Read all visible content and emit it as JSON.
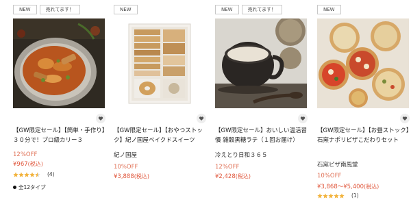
{
  "products": [
    {
      "badges": [
        "NEW",
        "売れてます！"
      ],
      "title": "【GW限定セール】【簡単・手作り】３０分で！プロ級カリー３",
      "shop": "",
      "discount": "12%OFF",
      "price": "¥967",
      "tax": "(税込)",
      "rating": 4.5,
      "review_count": "(4)",
      "types": "全12タイプ"
    },
    {
      "badges": [
        "NEW"
      ],
      "title": "【GW限定セール】【おやつストック】紀ノ国屋ベイクドスイーツ",
      "shop": "紀ノ国屋",
      "discount": "10%OFF",
      "price": "¥3,888",
      "tax": "(税込)"
    },
    {
      "badges": [
        "NEW",
        "売れてます！"
      ],
      "title": "【GW限定セール】おいしい温活習慣 雑穀黒糖ラテ（１回お届け）",
      "shop": "冷えとり日和３６５",
      "discount": "12%OFF",
      "price": "¥2,428",
      "tax": "(税込)"
    },
    {
      "badges": [
        "NEW"
      ],
      "title": "【GW限定セール】【お昼ストック】石窯ナポリピザこだわりセット",
      "shop": "石窯ピザ南風堂",
      "discount": "10%OFF",
      "price": "¥3,868〜¥5,400",
      "tax": "(税込)",
      "rating": 5,
      "review_count": "(1)"
    }
  ],
  "colors": {
    "price": "#e0573c",
    "discount": "#e07358",
    "star": "#f2b33d",
    "fav_bg": "#eeeeee"
  },
  "icons": {
    "favorite": "heart-icon",
    "rating": "star-icon",
    "variant_dot": "dot-icon"
  }
}
